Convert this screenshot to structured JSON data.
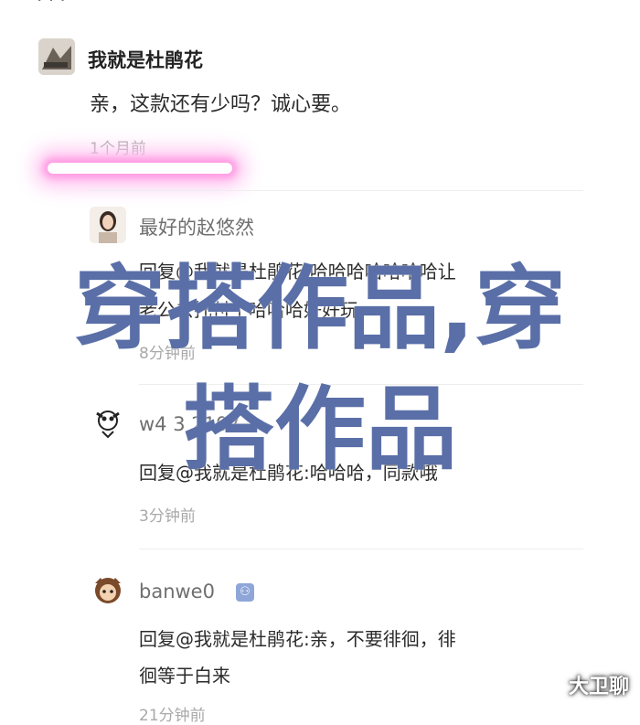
{
  "top": {
    "clipped_text": "· · ·"
  },
  "comment": {
    "user": "我就是杜鹃花",
    "text": "亲，这款还有少吗？诚心要。",
    "time": "1个月前"
  },
  "replies": [
    {
      "user": "最好的赵悠然",
      "line1": "回复@我就是杜鹃花:哈哈哈哈哈哈哈让",
      "line2": "老公去托付个哈哈哈好好玩",
      "time": "8分钟前"
    },
    {
      "user": "w4 3 2107",
      "line1": "回复@我就是杜鹃花:哈哈哈，同款哦",
      "time": "3分钟前"
    },
    {
      "user": "banwe0",
      "badge": "⚇",
      "line1": "回复@我就是杜鹃花:亲，不要徘徊，徘",
      "line2": "徊等于白来",
      "time": "21分钟前"
    }
  ],
  "watermark": {
    "line1": "穿搭作品,穿",
    "line2": "搭作品"
  },
  "corner_logo": "大卫聊",
  "colors": {
    "watermark": "#5a6fa7",
    "glow": "#ff9be3"
  }
}
